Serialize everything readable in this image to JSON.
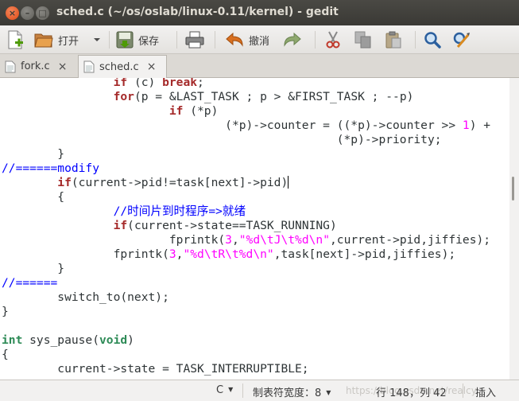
{
  "window": {
    "title": "sched.c (~/os/oslab/linux-0.11/kernel) - gedit",
    "close_glyph": "×",
    "minimize_glyph": "–",
    "maximize_glyph": "□"
  },
  "toolbar": {
    "open_label": "打开",
    "save_label": "保存",
    "undo_label": "撤消",
    "icons": [
      "new-document-icon",
      "open-folder-icon",
      "chevron-down-icon",
      "save-icon",
      "print-icon",
      "undo-icon",
      "redo-icon",
      "cut-icon",
      "copy-icon",
      "paste-icon",
      "search-icon",
      "find-replace-icon"
    ]
  },
  "tabs": [
    {
      "label": "fork.c",
      "close": "×",
      "active": false
    },
    {
      "label": "sched.c",
      "close": "×",
      "active": true
    }
  ],
  "code": {
    "cursor_line": 148,
    "lines": [
      "                if (c) break;",
      "                for(p = &LAST_TASK ; p > &FIRST_TASK ; --p)",
      "                        if (*p)",
      "                                (*p)->counter = ((*p)->counter >> 1) +",
      "                                                (*p)->priority;",
      "        }",
      "//======modify",
      "        if(current->pid!=task[next]->pid)",
      "        {",
      "                //时间片到时程序=>就绪",
      "                if(current->state==TASK_RUNNING)",
      "                        fprintk(3,\"%d\\tJ\\t%d\\n\",current->pid,jiffies);",
      "                fprintk(3,\"%d\\tR\\t%d\\n\",task[next]->pid,jiffies);",
      "        }",
      "//======",
      "        switch_to(next);",
      "}",
      "",
      "int sys_pause(void)",
      "{",
      "        current->state = TASK_INTERRUPTIBLE;"
    ]
  },
  "statusbar": {
    "language": "C",
    "tab_width": "制表符宽度：8",
    "position": "行 148，列 42",
    "mode": "插入",
    "watermark": "https://blog.csdn.net/realcy"
  },
  "colors": {
    "keyword": "#a52a2a",
    "type": "#2e8b57",
    "comment": "#0000ff",
    "number_string": "#ff00ff",
    "titlebar": "#3c3b37",
    "close_button": "#df4a16"
  }
}
